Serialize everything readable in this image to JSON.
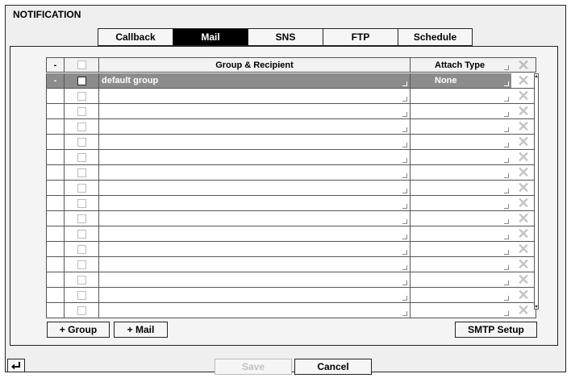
{
  "page": {
    "title": "NOTIFICATION"
  },
  "tabs": [
    "Callback",
    "Mail",
    "SNS",
    "FTP",
    "Schedule"
  ],
  "active_tab": "Mail",
  "table": {
    "header": {
      "minus": "-",
      "group_recipient": "Group & Recipient",
      "attach_type": "Attach Type"
    },
    "rows": [
      {
        "minus": "-",
        "group": "default group",
        "attach": "None",
        "selected": true
      },
      {
        "minus": "",
        "group": "",
        "attach": ""
      },
      {
        "minus": "",
        "group": "",
        "attach": ""
      },
      {
        "minus": "",
        "group": "",
        "attach": ""
      },
      {
        "minus": "",
        "group": "",
        "attach": ""
      },
      {
        "minus": "",
        "group": "",
        "attach": ""
      },
      {
        "minus": "",
        "group": "",
        "attach": ""
      },
      {
        "minus": "",
        "group": "",
        "attach": ""
      },
      {
        "minus": "",
        "group": "",
        "attach": ""
      },
      {
        "minus": "",
        "group": "",
        "attach": ""
      },
      {
        "minus": "",
        "group": "",
        "attach": ""
      },
      {
        "minus": "",
        "group": "",
        "attach": ""
      },
      {
        "minus": "",
        "group": "",
        "attach": ""
      },
      {
        "minus": "",
        "group": "",
        "attach": ""
      },
      {
        "minus": "",
        "group": "",
        "attach": ""
      },
      {
        "minus": "",
        "group": "",
        "attach": ""
      }
    ]
  },
  "buttons": {
    "add_group": "+ Group",
    "add_mail": "+ Mail",
    "smtp_setup": "SMTP Setup",
    "save": "Save",
    "cancel": "Cancel"
  },
  "icons": {
    "delete": "close-x-icon",
    "back": "return-arrow-icon"
  },
  "colors": {
    "selected_row": "#8c8c8c",
    "active_tab": "#000000",
    "disabled_text": "#c0c0c0"
  }
}
